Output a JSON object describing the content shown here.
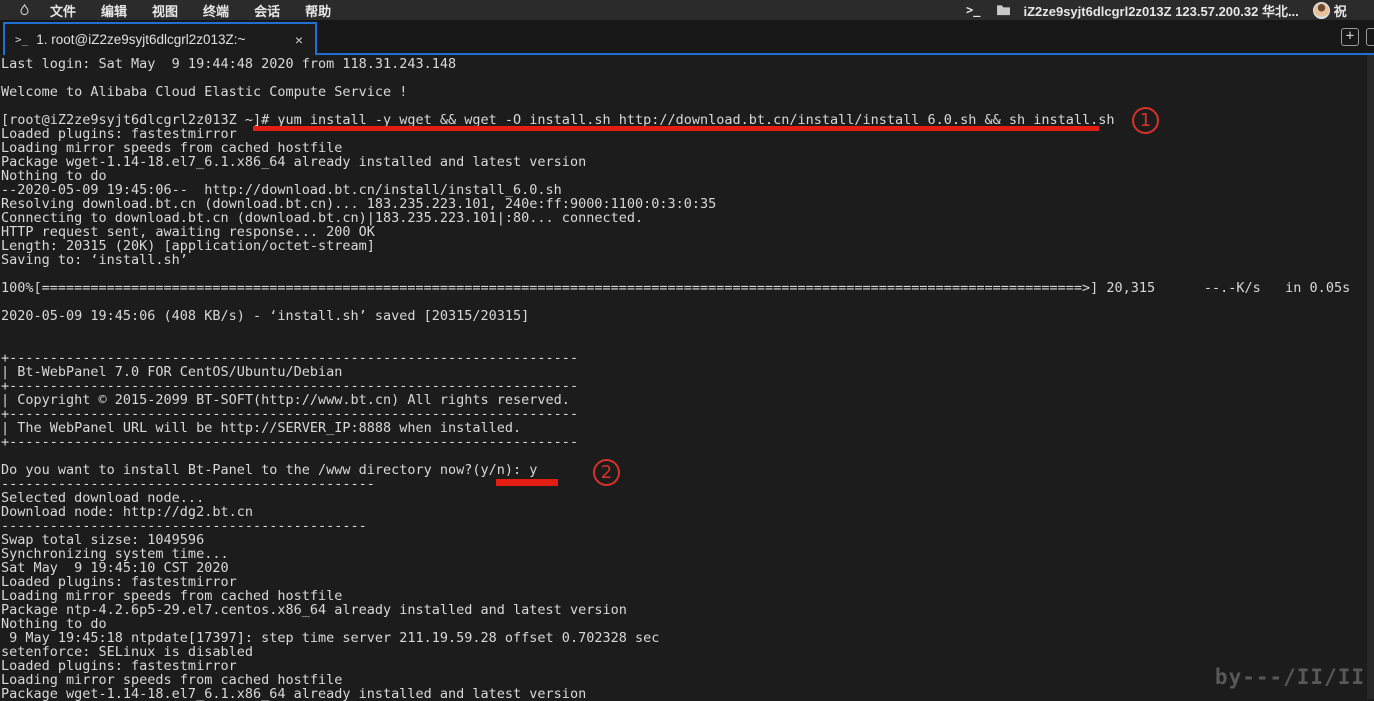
{
  "colors": {
    "accent_blue": "#1e70d5",
    "annotation_red": "#e41d12",
    "terminal_bg": "#1c1c1c",
    "terminal_fg": "#d8d8d8"
  },
  "menubar": {
    "app_icon": "droplet-icon",
    "items": [
      {
        "label": "文件"
      },
      {
        "label": "编辑"
      },
      {
        "label": "视图"
      },
      {
        "label": "终端"
      },
      {
        "label": "会话"
      },
      {
        "label": "帮助"
      }
    ],
    "right": {
      "terminal_glyph": ">_",
      "folder_icon": "folder-icon",
      "host_summary": "iZ2ze9syjt6dlcgrl2z013Z 123.57.200.32 华北...",
      "avatar_text": "祝"
    }
  },
  "tabbar": {
    "tab": {
      "icon_glyph": ">_",
      "title": "1. root@iZ2ze9syjt6dlcgrl2z013Z:~",
      "close_label": "×"
    },
    "new_tab_label": "+"
  },
  "terminal": {
    "lines": [
      "Last login: Sat May  9 19:44:48 2020 from 118.31.243.148",
      "",
      "Welcome to Alibaba Cloud Elastic Compute Service !",
      "",
      "[root@iZ2ze9syjt6dlcgrl2z013Z ~]# yum install -y wget && wget -O install.sh http://download.bt.cn/install/install_6.0.sh && sh install.sh",
      "Loaded plugins: fastestmirror",
      "Loading mirror speeds from cached hostfile",
      "Package wget-1.14-18.el7_6.1.x86_64 already installed and latest version",
      "Nothing to do",
      "--2020-05-09 19:45:06--  http://download.bt.cn/install/install_6.0.sh",
      "Resolving download.bt.cn (download.bt.cn)... 183.235.223.101, 240e:ff:9000:1100:0:3:0:35",
      "Connecting to download.bt.cn (download.bt.cn)|183.235.223.101|:80... connected.",
      "HTTP request sent, awaiting response... 200 OK",
      "Length: 20315 (20K) [application/octet-stream]",
      "Saving to: ‘install.sh’",
      "",
      "100%[================================================================================================================================>] 20,315      --.-K/s   in 0.05s",
      "",
      "2020-05-09 19:45:06 (408 KB/s) - ‘install.sh’ saved [20315/20315]",
      "",
      "",
      "+----------------------------------------------------------------------",
      "| Bt-WebPanel 7.0 FOR CentOS/Ubuntu/Debian",
      "+----------------------------------------------------------------------",
      "| Copyright © 2015-2099 BT-SOFT(http://www.bt.cn) All rights reserved.",
      "+----------------------------------------------------------------------",
      "| The WebPanel URL will be http://SERVER_IP:8888 when installed.",
      "+----------------------------------------------------------------------",
      "",
      "Do you want to install Bt-Panel to the /www directory now?(y/n): y",
      "----------------------------------------------",
      "Selected download node...",
      "Download node: http://dg2.bt.cn",
      "---------------------------------------------",
      "Swap total sizse: 1049596",
      "Synchronizing system time...",
      "Sat May  9 19:45:10 CST 2020",
      "Loaded plugins: fastestmirror",
      "Loading mirror speeds from cached hostfile",
      "Package ntp-4.2.6p5-29.el7.centos.x86_64 already installed and latest version",
      "Nothing to do",
      " 9 May 19:45:18 ntpdate[17397]: step time server 211.19.59.28 offset 0.702328 sec",
      "setenforce: SELinux is disabled",
      "Loaded plugins: fastestmirror",
      "Loading mirror speeds from cached hostfile",
      "Package wget-1.14-18.el7_6.1.x86_64 already installed and latest version"
    ]
  },
  "annotations": {
    "marker1_label": "1",
    "marker2_label": "2"
  },
  "watermark": "by---/II/II"
}
